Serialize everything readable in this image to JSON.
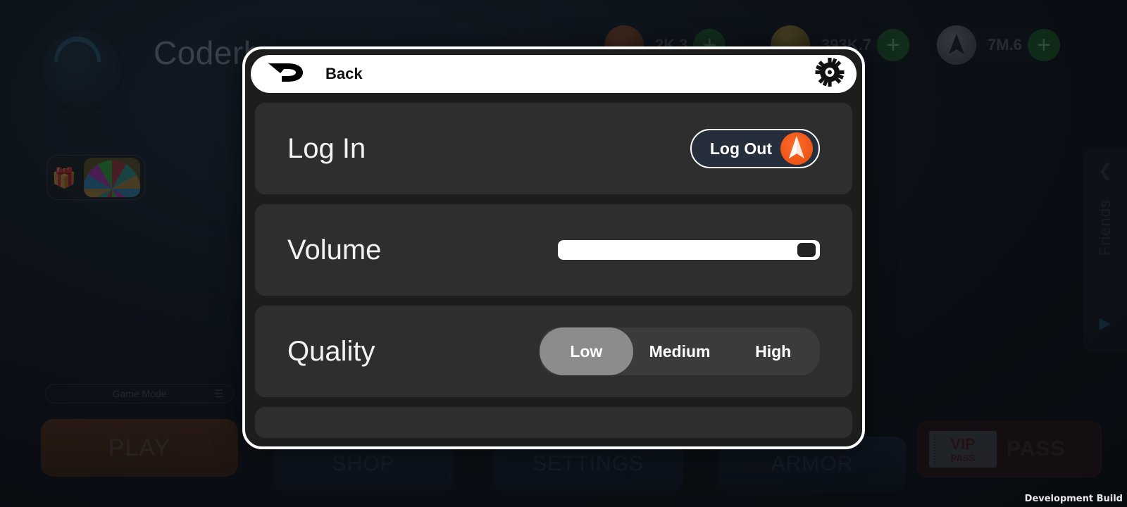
{
  "background": {
    "player": {
      "name": "Coderh",
      "avatar_icon": "player-avatar-icon"
    },
    "currencies": [
      {
        "icon": "gem-icon",
        "value": "2K.3",
        "plus_label": "+"
      },
      {
        "icon": "coin-icon",
        "value": "393K.7",
        "plus_label": "+"
      },
      {
        "icon": "nav-icon",
        "value": "7M.6",
        "plus_label": "+"
      }
    ],
    "reward_widget": {
      "gift_icon": "gift-icon",
      "wheel_icon": "spin-wheel-icon"
    },
    "game_mode": {
      "label": "Game Mode",
      "icon": "sliders-icon"
    },
    "play_button": {
      "label": "PLAY"
    },
    "bottom_buttons": [
      {
        "label": "SHOP"
      },
      {
        "label": "SETTINGS"
      },
      {
        "label": "ARMOR"
      }
    ],
    "vip_pass": {
      "ticket_line1": "VIP",
      "ticket_line2": "PASS",
      "label": "PASS"
    },
    "friends_panel": {
      "chevron_icon": "chevron-left-icon",
      "label": "Friends",
      "badge_icon": "friend-request-icon"
    },
    "dev_build_watermark": "Development Build"
  },
  "modal": {
    "header": {
      "back_icon": "back-arrow-icon",
      "back_label": "Back",
      "gear_icon": "gear-icon"
    },
    "rows": [
      {
        "label": "Log In",
        "control": "logout-button",
        "button_label": "Log Out",
        "button_icon": "crazygames-logo-icon"
      },
      {
        "label": "Volume",
        "control": "slider",
        "value": 100,
        "min": 0,
        "max": 100
      },
      {
        "label": "Quality",
        "control": "segmented",
        "options": [
          "Low",
          "Medium",
          "High"
        ],
        "selected": "Low"
      }
    ]
  },
  "colors": {
    "modal_bg": "#1d1d1d",
    "row_bg": "#2e2e2e",
    "modal_border": "#ffffff",
    "header_bg": "#ffffff",
    "accent_orange": "#ff6b2b",
    "logout_bg": "#262e3b",
    "quality_track": "#3b3b3b",
    "quality_selected": "#8c8c8c",
    "slider_fill": "#ffffff",
    "slider_handle": "#222222",
    "page_bg": "#0d1117"
  }
}
